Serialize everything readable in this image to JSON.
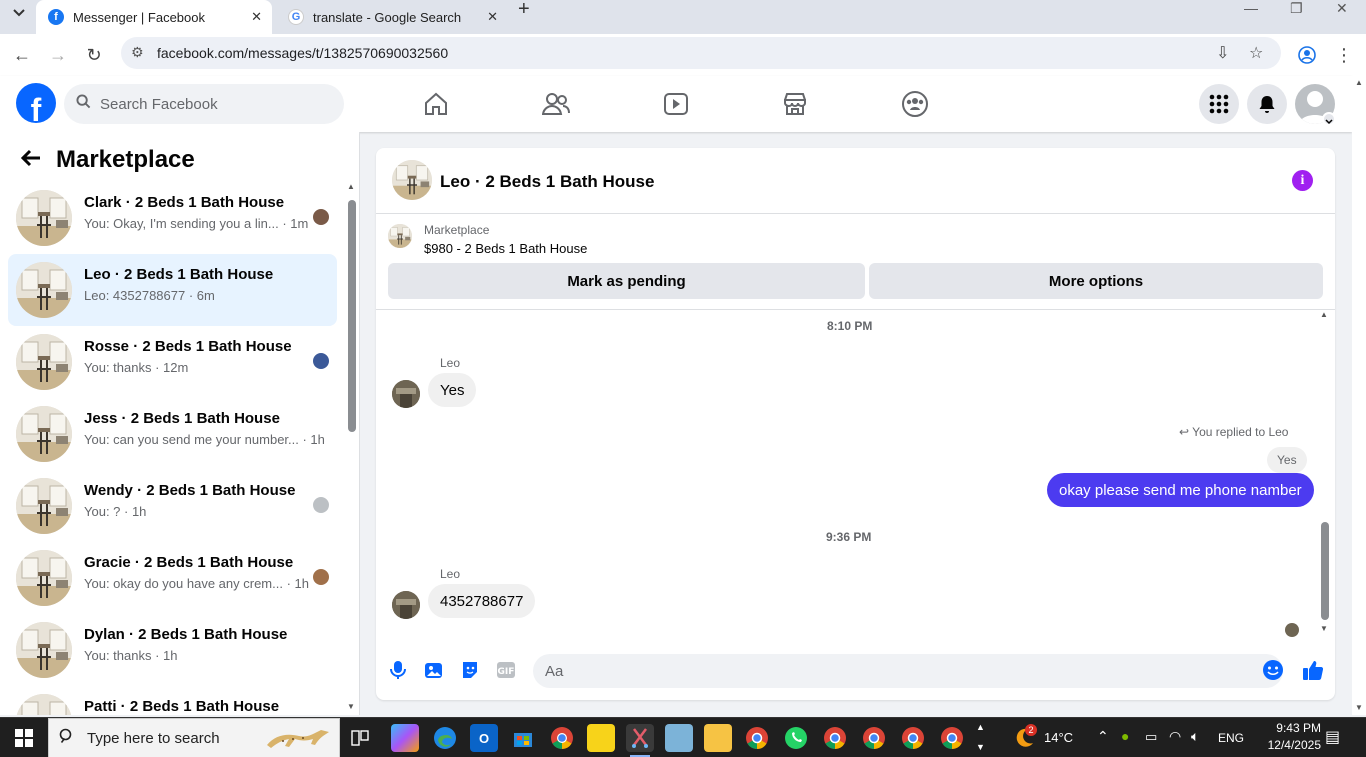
{
  "browser": {
    "tabs": [
      {
        "title": "Messenger | Facebook",
        "favicon_color": "#1877f2"
      },
      {
        "title": "translate - Google Search",
        "favicon_color": "#4285f4"
      }
    ],
    "url": "facebook.com/messages/t/1382570690032560"
  },
  "fb_header": {
    "logo_letter": "f",
    "search_placeholder": "Search Facebook",
    "nav_icons": [
      "home-icon",
      "friends-icon",
      "watch-icon",
      "marketplace-icon",
      "groups-icon"
    ],
    "right_icons": [
      "menu-grid-icon",
      "notifications-bell-icon",
      "profile-avatar"
    ]
  },
  "left_panel": {
    "title": "Marketplace",
    "conversations": [
      {
        "title": "Clark · 2 Beds 1 Bath House",
        "subtitle": "You: Okay, I'm sending you a lin... · 1m",
        "selected": false,
        "mini_color": "#7a5a48"
      },
      {
        "title": "Leo · 2 Beds 1 Bath House",
        "subtitle": "Leo: 4352788677 · 6m",
        "selected": true,
        "mini_color": ""
      },
      {
        "title": "Rosse · 2 Beds 1 Bath House",
        "subtitle": "You: thanks · 12m",
        "selected": false,
        "mini_color": "#3b5998"
      },
      {
        "title": "Jess · 2 Beds 1 Bath House",
        "subtitle": "You: can you send me your number... · 1h",
        "selected": false,
        "mini_color": ""
      },
      {
        "title": "Wendy · 2 Beds 1 Bath House",
        "subtitle": "You: ? · 1h",
        "selected": false,
        "mini_color": "#bcc0c4"
      },
      {
        "title": "Gracie · 2 Beds 1 Bath House",
        "subtitle": "You: okay do you have any crem... · 1h",
        "selected": false,
        "mini_color": "#a0704a"
      },
      {
        "title": "Dylan · 2 Beds 1 Bath House",
        "subtitle": "You: thanks · 1h",
        "selected": false,
        "mini_color": ""
      },
      {
        "title": "Patti · 2 Beds 1 Bath House",
        "subtitle": "",
        "selected": false,
        "mini_color": ""
      }
    ]
  },
  "chat": {
    "title": "Leo · 2 Beds 1 Bath House",
    "marketplace_label": "Marketplace",
    "listing": "$980 - 2 Beds 1 Bath House",
    "buttons": {
      "mark_pending": "Mark as pending",
      "more_options": "More options"
    },
    "messages": {
      "time1": "8:10 PM",
      "sender1": "Leo",
      "msg1": "Yes",
      "reply_note": "You replied to Leo",
      "quoted": "Yes",
      "msg_out": "okay please send me phone namber",
      "time2": "9:36 PM",
      "sender2": "Leo",
      "msg2": "4352788677"
    },
    "composer_placeholder": "Aa",
    "accent_color": "#0866ff"
  },
  "taskbar": {
    "search_placeholder": "Type here to search",
    "weather_badge": "2",
    "temperature": "14°C",
    "language": "ENG",
    "time": "9:43 PM",
    "date": "12/4/2025"
  }
}
